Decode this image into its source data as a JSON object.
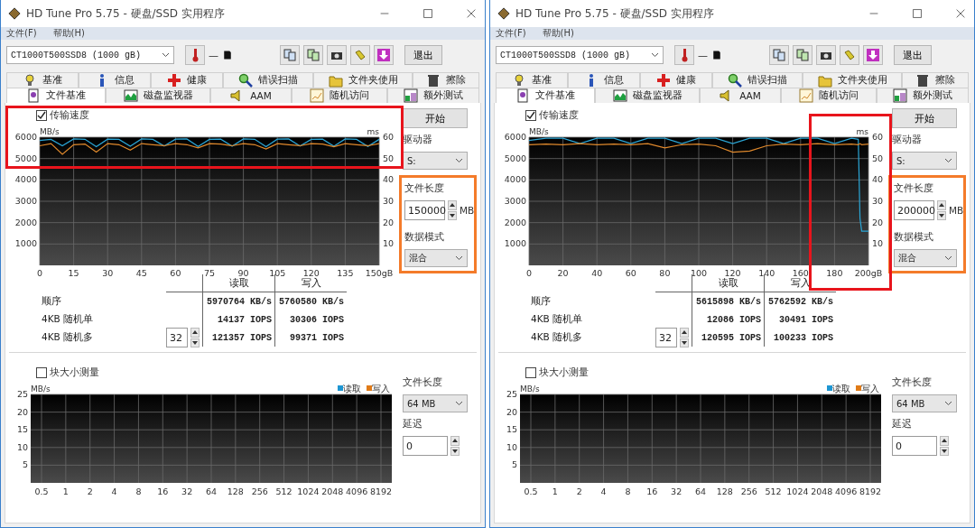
{
  "windows": [
    {
      "title": "HD Tune Pro 5.75 - 硬盘/SSD 实用程序",
      "menu": [
        "文件(F)",
        "帮助(H)"
      ],
      "drive": "CT1000T500SSD8 (1000 gB)",
      "temperature": "—",
      "exit_button": "退出",
      "tabs_row1": [
        {
          "label": "基准",
          "selected": false
        },
        {
          "label": "信息",
          "selected": false
        },
        {
          "label": "健康",
          "selected": false
        },
        {
          "label": "错误扫描",
          "selected": false
        },
        {
          "label": "文件夹使用",
          "selected": false
        },
        {
          "label": "擦除",
          "selected": false
        }
      ],
      "tabs_row2": [
        {
          "label": "文件基准",
          "selected": true
        },
        {
          "label": "磁盘监视器",
          "selected": false
        },
        {
          "label": "AAM",
          "selected": false
        },
        {
          "label": "随机访问",
          "selected": false
        },
        {
          "label": "额外测试",
          "selected": false
        }
      ],
      "transfer_checkbox": {
        "label": "传输速度",
        "checked": true
      },
      "chart_data": {
        "type": "line",
        "grid": true,
        "ylabel": "MB/s",
        "y2label": "ms",
        "y2lim": [
          0,
          60
        ],
        "xlim": [
          0,
          150
        ],
        "ylim": [
          0,
          6000
        ],
        "xticks": [
          0,
          15,
          30,
          45,
          60,
          75,
          90,
          105,
          120,
          135,
          {
            "value": 150,
            "label": "150gB"
          }
        ],
        "yticks": [
          1000,
          2000,
          3000,
          4000,
          5000,
          6000
        ],
        "y2ticks": [
          10,
          20,
          30,
          40,
          50,
          60
        ],
        "x": [
          0,
          5,
          10,
          15,
          20,
          25,
          30,
          35,
          40,
          45,
          50,
          55,
          60,
          65,
          70,
          75,
          80,
          85,
          90,
          95,
          100,
          105,
          110,
          115,
          120,
          125,
          130,
          135,
          140,
          145,
          150
        ],
        "series": [
          {
            "color": "#2ba6d6",
            "values": [
              5850,
              5900,
              5600,
              5920,
              5900,
              5560,
              5910,
              5900,
              5580,
              5920,
              5900,
              5590,
              5910,
              5920,
              5570,
              5900,
              5910,
              5580,
              5920,
              5900,
              5560,
              5910,
              5920,
              5590,
              5900,
              5910,
              5580,
              5920,
              5900,
              5570,
              5900
            ]
          },
          {
            "color": "#e0892c",
            "values": [
              5600,
              5700,
              5200,
              5650,
              5680,
              5300,
              5700,
              5650,
              5400,
              5700,
              5650,
              5600,
              5700,
              5650,
              5500,
              5700,
              5680,
              5600,
              5700,
              5650,
              5450,
              5700,
              5650,
              5600,
              5700,
              5680,
              5550,
              5700,
              5650,
              5600,
              5700
            ]
          }
        ]
      },
      "start_button": "开始",
      "drive_label": "驱动器",
      "drive_select": "S:",
      "file_length_label": "文件长度",
      "file_length": "150000",
      "file_length_unit": "MB",
      "data_mode_label": "数据模式",
      "data_mode": "混合",
      "results": {
        "columns": [
          "读取",
          "写入"
        ],
        "rows": [
          {
            "label": "顺序",
            "read": "5970764 KB/s",
            "write": "5760580 KB/s"
          },
          {
            "label": "4KB 随机单",
            "read": "14137 IOPS",
            "write": "30306 IOPS"
          },
          {
            "label": "4KB 随机多",
            "queue": "32",
            "read": "121357 IOPS",
            "write": "99371 IOPS"
          }
        ]
      },
      "block_checkbox": {
        "label": "块大小测量",
        "checked": false
      },
      "block_test": {
        "chart_data": {
          "type": "bar",
          "grid": true,
          "ylabel": "MB/s",
          "ylim": [
            0,
            25
          ],
          "yticks": [
            5,
            10,
            15,
            20,
            25
          ],
          "categories": [
            "0.5",
            "1",
            "2",
            "4",
            "8",
            "16",
            "32",
            "64",
            "128",
            "256",
            "512",
            "1024",
            "2048",
            "4096",
            "8192"
          ],
          "series": [
            {
              "name": "读取",
              "color": "#1e96d2",
              "values": [
                null,
                null,
                null,
                null,
                null,
                null,
                null,
                null,
                null,
                null,
                null,
                null,
                null,
                null,
                null
              ]
            },
            {
              "name": "写入",
              "color": "#e07b18",
              "values": [
                null,
                null,
                null,
                null,
                null,
                null,
                null,
                null,
                null,
                null,
                null,
                null,
                null,
                null,
                null
              ]
            }
          ]
        },
        "file_length_label": "文件长度",
        "file_length": "64 MB",
        "delay_label": "延迟",
        "delay": "0"
      },
      "markups": [
        {
          "kind": "chart-top",
          "color": "#e8141c"
        },
        {
          "kind": "settings",
          "color": "#f47b2a"
        }
      ]
    },
    {
      "title": "HD Tune Pro 5.75 - 硬盘/SSD 实用程序",
      "menu": [
        "文件(F)",
        "帮助(H)"
      ],
      "drive": "CT1000T500SSD8 (1000 gB)",
      "temperature": "—",
      "exit_button": "退出",
      "tabs_row1": [
        {
          "label": "基准",
          "selected": false
        },
        {
          "label": "信息",
          "selected": false
        },
        {
          "label": "健康",
          "selected": false
        },
        {
          "label": "错误扫描",
          "selected": false
        },
        {
          "label": "文件夹使用",
          "selected": false
        },
        {
          "label": "擦除",
          "selected": false
        }
      ],
      "tabs_row2": [
        {
          "label": "文件基准",
          "selected": true
        },
        {
          "label": "磁盘监视器",
          "selected": false
        },
        {
          "label": "AAM",
          "selected": false
        },
        {
          "label": "随机访问",
          "selected": false
        },
        {
          "label": "额外测试",
          "selected": false
        }
      ],
      "transfer_checkbox": {
        "label": "传输速度",
        "checked": true
      },
      "chart_data": {
        "type": "line",
        "grid": true,
        "ylabel": "MB/s",
        "y2label": "ms",
        "y2lim": [
          0,
          60
        ],
        "xlim": [
          0,
          200
        ],
        "ylim": [
          0,
          6000
        ],
        "xticks": [
          0,
          20,
          40,
          60,
          80,
          100,
          120,
          140,
          160,
          180,
          {
            "value": 200,
            "label": "200gB"
          }
        ],
        "yticks": [
          1000,
          2000,
          3000,
          4000,
          5000,
          6000
        ],
        "y2ticks": [
          10,
          20,
          30,
          40,
          50,
          60
        ],
        "x": [
          0,
          10,
          20,
          30,
          40,
          50,
          60,
          70,
          80,
          90,
          100,
          110,
          120,
          130,
          140,
          150,
          160,
          170,
          180,
          190,
          194,
          195,
          196,
          200
        ],
        "series": [
          {
            "color": "#2ba6d6",
            "values": [
              5850,
              5950,
              5950,
              5700,
              5950,
              5950,
              5700,
              5950,
              5950,
              5700,
              5950,
              5950,
              5700,
              5950,
              5950,
              5700,
              5950,
              5950,
              5700,
              5950,
              5900,
              2200,
              1600,
              1600
            ]
          },
          {
            "color": "#e0892c",
            "values": [
              5650,
              5680,
              5650,
              5700,
              5650,
              5680,
              5650,
              5700,
              5500,
              5650,
              5680,
              5600,
              5300,
              5350,
              5600,
              5680,
              5650,
              5700,
              5650,
              5680,
              5650,
              5700,
              5650,
              5680
            ]
          }
        ]
      },
      "start_button": "开始",
      "drive_label": "驱动器",
      "drive_select": "S:",
      "file_length_label": "文件长度",
      "file_length": "200000",
      "file_length_unit": "MB",
      "data_mode_label": "数据模式",
      "data_mode": "混合",
      "results": {
        "columns": [
          "读取",
          "写入"
        ],
        "rows": [
          {
            "label": "顺序",
            "read": "5615898 KB/s",
            "write": "5762592 KB/s"
          },
          {
            "label": "4KB 随机单",
            "read": "12086 IOPS",
            "write": "30491 IOPS"
          },
          {
            "label": "4KB 随机多",
            "queue": "32",
            "read": "120595 IOPS",
            "write": "100233 IOPS"
          }
        ]
      },
      "block_checkbox": {
        "label": "块大小测量",
        "checked": false
      },
      "block_test": {
        "chart_data": {
          "type": "bar",
          "grid": true,
          "ylabel": "MB/s",
          "ylim": [
            0,
            25
          ],
          "yticks": [
            5,
            10,
            15,
            20,
            25
          ],
          "categories": [
            "0.5",
            "1",
            "2",
            "4",
            "8",
            "16",
            "32",
            "64",
            "128",
            "256",
            "512",
            "1024",
            "2048",
            "4096",
            "8192"
          ],
          "series": [
            {
              "name": "读取",
              "color": "#1e96d2",
              "values": [
                null,
                null,
                null,
                null,
                null,
                null,
                null,
                null,
                null,
                null,
                null,
                null,
                null,
                null,
                null
              ]
            },
            {
              "name": "写入",
              "color": "#e07b18",
              "values": [
                null,
                null,
                null,
                null,
                null,
                null,
                null,
                null,
                null,
                null,
                null,
                null,
                null,
                null,
                null
              ]
            }
          ]
        },
        "file_length_label": "文件长度",
        "file_length": "64 MB",
        "delay_label": "延迟",
        "delay": "0"
      },
      "markups": [
        {
          "kind": "chart-end",
          "color": "#e8141c"
        },
        {
          "kind": "settings",
          "color": "#f47b2a"
        }
      ]
    }
  ]
}
